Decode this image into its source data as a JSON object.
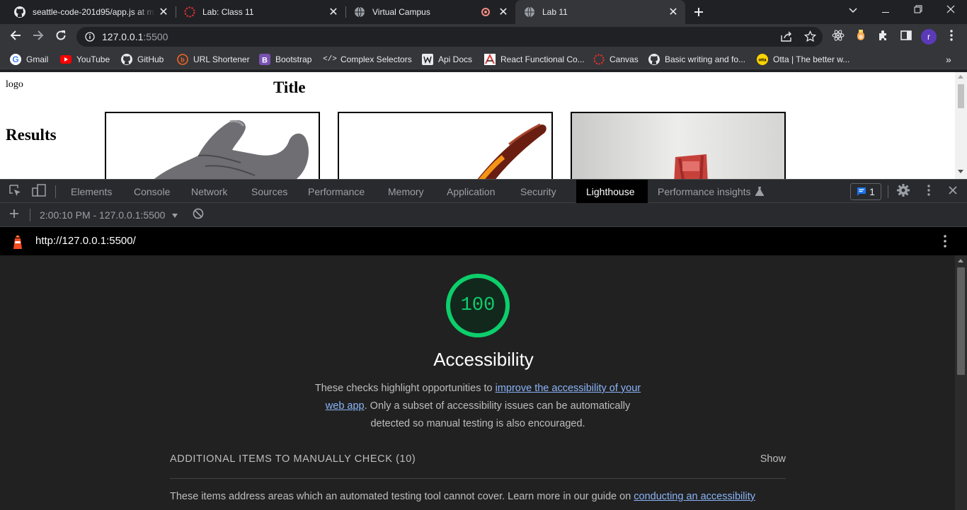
{
  "tabs": [
    {
      "title": "seattle-code-201d95/app.js at m",
      "icon": "github-icon"
    },
    {
      "title": "Lab: Class 11",
      "icon": "canvas-icon"
    },
    {
      "title": "Virtual Campus",
      "icon": "globe-icon",
      "recording": true
    },
    {
      "title": "Lab 11",
      "icon": "globe-icon",
      "active": true
    }
  ],
  "address": {
    "host": "127.0.0.1",
    "port": ":5500"
  },
  "bookmarks": [
    {
      "label": "Gmail",
      "icon": "google-icon"
    },
    {
      "label": "YouTube",
      "icon": "youtube-icon"
    },
    {
      "label": "GitHub",
      "icon": "github-icon"
    },
    {
      "label": "URL Shortener",
      "icon": "url-shortener-icon"
    },
    {
      "label": "Bootstrap",
      "icon": "bootstrap-icon"
    },
    {
      "label": "Complex Selectors",
      "icon": "code-icon"
    },
    {
      "label": "Api Docs",
      "icon": "api-docs-icon"
    },
    {
      "label": "React Functional Co...",
      "icon": "react-doc-icon"
    },
    {
      "label": "Canvas",
      "icon": "canvas-icon"
    },
    {
      "label": "Basic writing and fo...",
      "icon": "github-icon"
    },
    {
      "label": "Otta | The better w...",
      "icon": "otta-icon"
    }
  ],
  "profile_initial": "r",
  "page": {
    "logo_alt": "logo",
    "title": "Title",
    "results_heading": "Results"
  },
  "devtools": {
    "tabs": [
      "Elements",
      "Console",
      "Network",
      "Sources",
      "Performance",
      "Memory",
      "Application",
      "Security",
      "Lighthouse",
      "Performance insights"
    ],
    "active_tab": "Lighthouse",
    "issues_count": "1",
    "report_selector": "2:00:10 PM - 127.0.0.1:5500"
  },
  "report": {
    "url": "http://127.0.0.1:5500/",
    "score": "100",
    "score_color": "#0cce6b",
    "category": "Accessibility",
    "desc_before": "These checks highlight opportunities to ",
    "desc_link": "improve the accessibility of your web app",
    "desc_after": ". Only a subset of accessibility issues can be automatically detected so manual testing is also encouraged.",
    "manual_title": "ADDITIONAL ITEMS TO MANUALLY CHECK (10)",
    "manual_toggle": "Show",
    "manual_desc_before": "These items address areas which an automated testing tool cannot cover. Learn more in our guide on ",
    "manual_desc_link": "conducting an accessibility"
  }
}
